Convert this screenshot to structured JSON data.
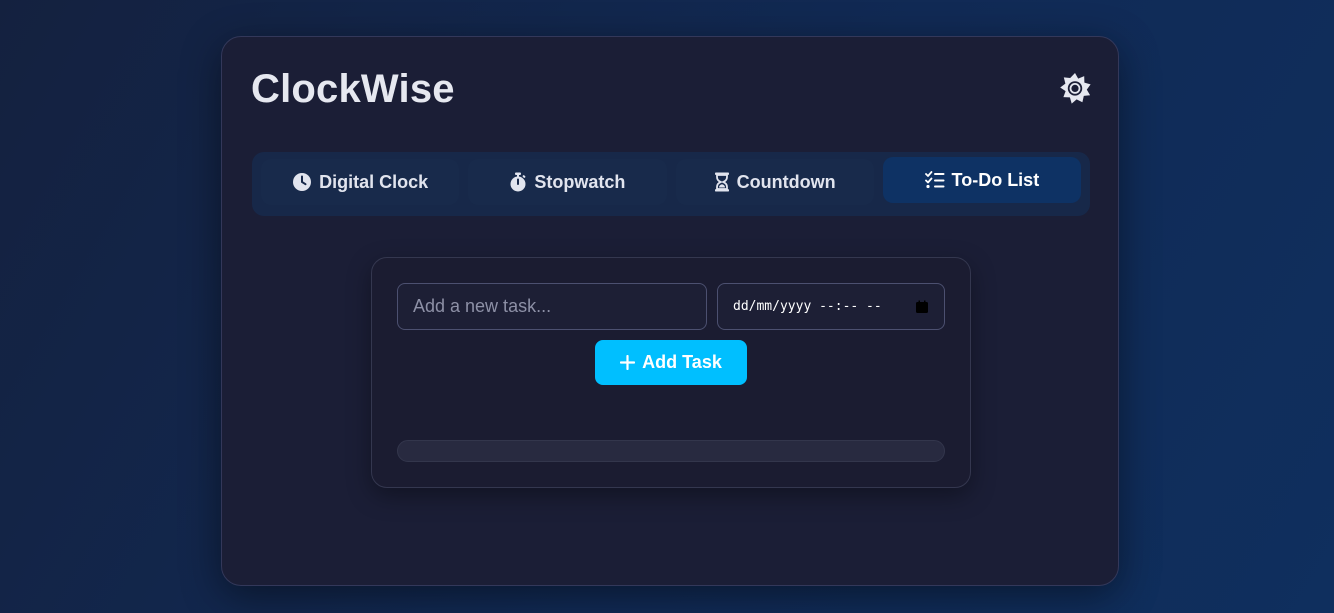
{
  "app": {
    "title": "ClockWise"
  },
  "theme_toggle": {
    "icon": "sun-icon"
  },
  "tabs": [
    {
      "label": "Digital Clock",
      "icon": "clock-icon",
      "active": false
    },
    {
      "label": "Stopwatch",
      "icon": "stopwatch-icon",
      "active": false
    },
    {
      "label": "Countdown",
      "icon": "hourglass-icon",
      "active": false
    },
    {
      "label": "To-Do List",
      "icon": "checklist-icon",
      "active": true
    }
  ],
  "todo": {
    "task_placeholder": "Add a new task...",
    "task_value": "",
    "datetime_placeholder": "dd/mm/yyyy --:-- --",
    "add_button_label": "Add Task",
    "add_button_icon": "plus-icon",
    "progress_fraction": 0
  },
  "colors": {
    "accent": "#00bfff",
    "card_bg": "#1b1e36",
    "active_tab_bg": "#0e3264"
  }
}
